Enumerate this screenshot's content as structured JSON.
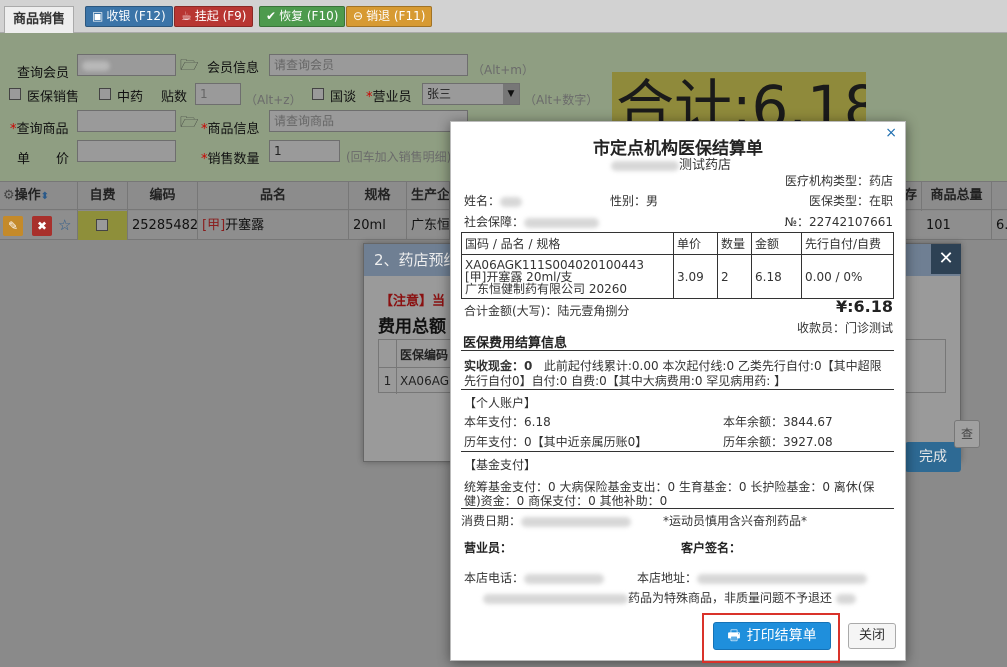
{
  "tabs": {
    "active": "商品销售"
  },
  "toolbar": {
    "checkout": "收银 (F12)",
    "hold": "挂起 (F9)",
    "restore": "恢复 (F10)",
    "refund": "销退 (F11)",
    "colors": {
      "checkout": "#3b74a8",
      "hold": "#b83632",
      "restore": "#4d9a4d",
      "refund": "#d79a32"
    }
  },
  "form": {
    "member_query_label": "查询会员",
    "member_info_label": "会员信息",
    "member_info_placeholder": "请查询会员",
    "member_hint": "（Alt+m）",
    "medicare_sale_label": "医保销售",
    "tcm_label": "中药",
    "doses_label": "贴数",
    "doses_value": "1",
    "doses_hint": "（Alt+z）",
    "national_label": "国谈",
    "salesperson_label": "营业员",
    "salesperson_value": "张三",
    "salesperson_hint": "（Alt+数字）",
    "product_query_label": "查询商品",
    "product_info_label": "商品信息",
    "product_info_placeholder": "请查询商品",
    "price_label": "单　　价",
    "qty_label": "销售数量",
    "qty_value": "1",
    "qty_hint": "(回车加入销售明细)",
    "total_text": "合计:6.18"
  },
  "grid": {
    "headers": [
      "操作",
      "自费",
      "编码",
      "品名",
      "规格",
      "生产企",
      "存",
      "商品总量"
    ],
    "row": {
      "code": "25285482",
      "name_tag": "[甲]",
      "name": "开塞露",
      "spec": "20ml",
      "maker": "广东恒",
      "stock_total": "101",
      "extra": "6."
    }
  },
  "dialog2": {
    "title": "2、药店预结",
    "notice": "【注意】当",
    "fee_total": "费用总额",
    "col_code": "医保编码",
    "row_no": "1",
    "row_code": "XA06AG",
    "done_btn": "完成",
    "side_btn": "查"
  },
  "receipt": {
    "title": "市定点机构医保结算单",
    "store_suffix": "测试药店",
    "inst_type": "医疗机构类型：药店",
    "name_label": "姓名：",
    "gender": "性别：男",
    "insurance_type": "医保类型：在职",
    "social_label": "社会保障：",
    "number": "№：22742107661",
    "table_headers": [
      "国码 / 品名 / 规格",
      "单价",
      "数量",
      "金额",
      "先行自付/自费"
    ],
    "item": {
      "code": "XA06AGK111S004020100443",
      "name_spec": "[甲]开塞露 20ml/支",
      "maker": "广东恒健制药有限公司 20260",
      "price": "3.09",
      "qty": "2",
      "amount": "6.18",
      "self_pay": "0.00 / 0%"
    },
    "total_caps": "合计金额(大写)：陆元壹角捌分",
    "total_amount": "¥:6.18",
    "cashier": "收款员：门诊测试",
    "settle_header": "医保费用结算信息",
    "cash_paid_label": "实收现金：",
    "cash_paid_value": "0",
    "cash_detail_1": "此前起付线累计:0.00  本次起付线:0  乙类先行自付:0【其中超限",
    "cash_detail_2": "先行自付0】自付:0  自费:0【其中大病费用:0 罕见病用药: 】",
    "personal_header": "【个人账户】",
    "year_pay": "本年支付：6.18",
    "year_balance": "本年余额：3844.67",
    "hist_pay": "历年支付：0【其中近亲属历账0】",
    "hist_balance": "历年余额：3927.08",
    "fund_header": "【基金支付】",
    "fund_line1": "统筹基金支付：0  大病保险基金支出：0  生育基金：0  长护险基金：0  离休(保",
    "fund_line2": "健)资金：0  商保支付：0  其他补助：0",
    "date_label": "消费日期：",
    "doping_note": "*运动员慎用含兴奋剂药品*",
    "sales_label": "营业员：",
    "customer_sign": "客户签名：",
    "phone_label": "本店电话：",
    "address_label": "本店地址：",
    "special_note": "药品为特殊商品，非质量问题不予退还",
    "print_btn": "打印结算单",
    "close_btn": "关闭"
  }
}
